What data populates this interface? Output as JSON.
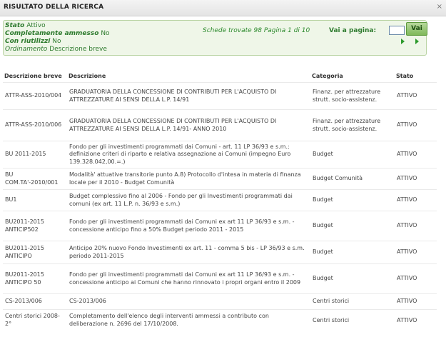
{
  "window": {
    "title": "RISULTATO DELLA RICERCA",
    "close_symbol": "×"
  },
  "filter": {
    "stato_label": "Stato",
    "stato_value": "Attivo",
    "ammesso_label": "Completamente ammesso",
    "ammesso_value": "No",
    "riutilizzi_label": "Con riutilizzi",
    "riutilizzi_value": "No",
    "ordinamento_label": "Ordinamento",
    "ordinamento_value": "Descrizione breve",
    "schede_text": "Schede trovate 98 Pagina 1 di 10",
    "goto_label": "Vai a pagina:",
    "goto_value": "",
    "goto_button": "Vai"
  },
  "table": {
    "headers": [
      "Descrizione breve",
      "Descrizione",
      "Categoria",
      "Stato"
    ],
    "rows": [
      {
        "breve": "ATTR-ASS-2010/004",
        "descr": "GRADUATORIA DELLA CONCESSIONE DI CONTRIBUTI PER L'ACQUISTO DI ATTREZZATURE AI SENSI DELLA L.P. 14/91",
        "cat": "Finanz. per attrezzature strutt. socio-assistenz.",
        "stato": "ATTIVO"
      },
      {
        "breve": "ATTR-ASS-2010/006",
        "descr": "GRADUATORIA DELLA CONCESSIONE DI CONTRIBUTI PER L'ACQUISTO DI ATTREZZATURE AI SENSI DELLA L.P. 14/91- ANNO 2010",
        "cat": "Finanz. per attrezzature strutt. socio-assistenz.",
        "stato": "ATTIVO"
      },
      {
        "breve": "BU 2011-2015",
        "descr": "Fondo per gli investimenti programmati dai Comuni - art. 11 LP 36/93 e s.m.: definizione criteri di riparto e relativa assegnazione ai Comuni (impegno Euro 139.328.042,00.=.)",
        "cat": "Budget",
        "stato": "ATTIVO"
      },
      {
        "breve": "BU COM.TA'-2010/001",
        "descr": "Modalità' attuative transitorie punto A.8) Protocollo d'intesa in materia di finanza locale per il 2010 - Budget Comunità",
        "cat": "Budget Comunità",
        "stato": "ATTIVO"
      },
      {
        "breve": "BU1",
        "descr": "Budget complessivo fino al 2006 - Fondo per gli Investimenti programmati dai comuni (ex art. 11 L.P. n. 36/93 e s.m.)",
        "cat": "Budget",
        "stato": "ATTIVO"
      },
      {
        "breve": "BU2011-2015 ANTICIP502",
        "descr": "Fondo per gli investimenti programmati dai Comuni ex art 11 LP 36/93 e s.m. - concessione anticipo fino a 50% Budget periodo 2011 - 2015",
        "cat": "Budget",
        "stato": "ATTIVO"
      },
      {
        "breve": "BU2011-2015 ANTICIPO",
        "descr": "Anticipo 20% nuovo Fondo Investimenti ex art. 11 - comma 5 bis - LP 36/93 e s.m. periodo 2011-2015",
        "cat": "Budget",
        "stato": "ATTIVO"
      },
      {
        "breve": "BU2011-2015 ANTICIPO 50",
        "descr": "Fondo per gli investimenti programmati dai Comuni ex art 11 LP 36/93 e s.m. - concessione anticipo ai Comuni che hanno rinnovato i propri organi entro il 2009",
        "cat": "Budget",
        "stato": "ATTIVO"
      },
      {
        "breve": "CS-2013/006",
        "descr": "CS-2013/006",
        "cat": "Centri storici",
        "stato": "ATTIVO"
      },
      {
        "breve": "Centri storici 2008-2°",
        "descr": "Completamento dell'elenco degli interventi ammessi a contributo con deliberazione n. 2696 del 17/10/2008.",
        "cat": "Centri storici",
        "stato": "ATTIVO"
      }
    ]
  },
  "colors": {
    "accent_green": "#2d7a2d",
    "panel_bg": "#eff6e8"
  },
  "icons": [
    "close-icon",
    "next-page-icon",
    "last-page-icon"
  ]
}
